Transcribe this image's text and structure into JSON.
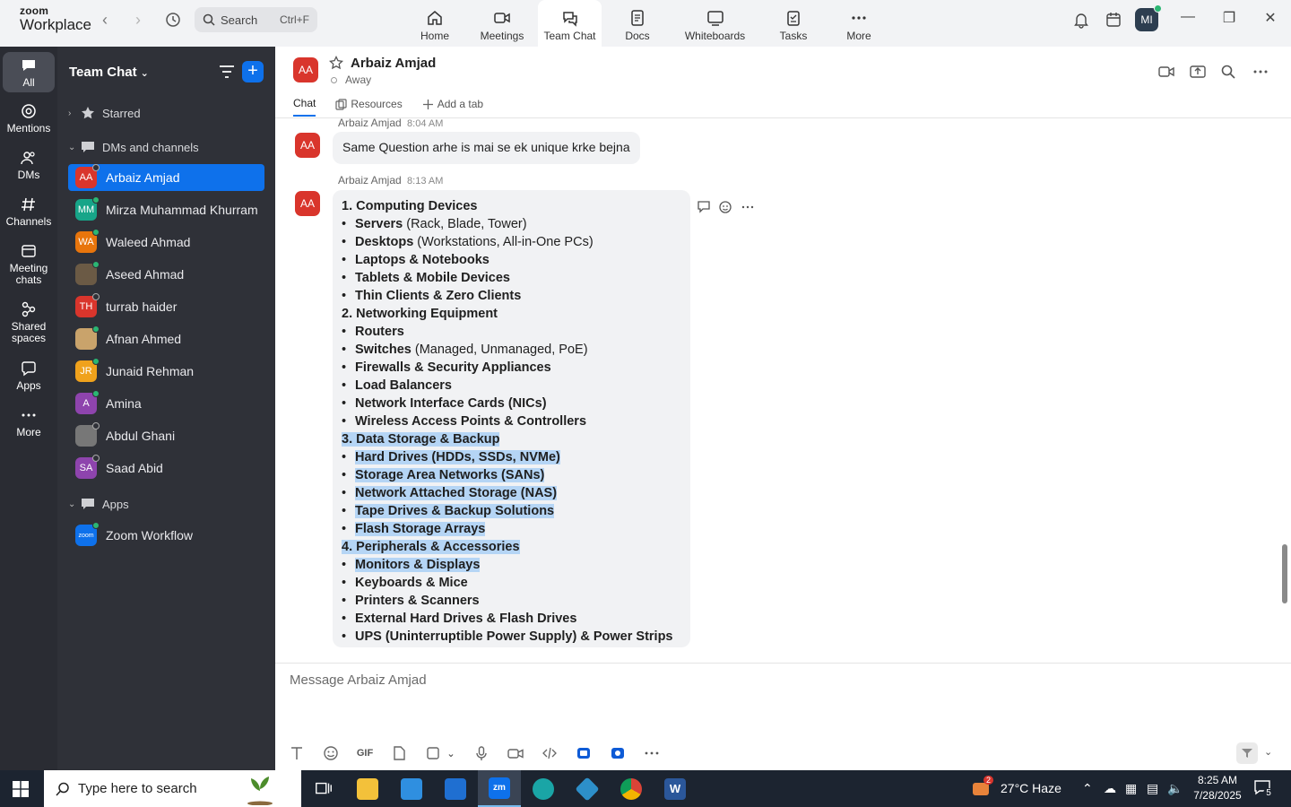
{
  "app": {
    "logo_line1": "zoom",
    "logo_line2": "Workplace",
    "search_label": "Search",
    "search_shortcut": "Ctrl+F",
    "user_initials": "MI"
  },
  "nav_tabs": [
    {
      "label": "Home",
      "icon": "home-icon"
    },
    {
      "label": "Meetings",
      "icon": "video-camera-icon"
    },
    {
      "label": "Team Chat",
      "icon": "chat-bubbles-icon"
    },
    {
      "label": "Docs",
      "icon": "document-icon"
    },
    {
      "label": "Whiteboards",
      "icon": "whiteboard-icon"
    },
    {
      "label": "Tasks",
      "icon": "tasks-icon"
    },
    {
      "label": "More",
      "icon": "more-dots-icon"
    }
  ],
  "rail": [
    {
      "label": "All"
    },
    {
      "label": "Mentions"
    },
    {
      "label": "DMs"
    },
    {
      "label": "Channels"
    },
    {
      "label": "Meeting chats"
    },
    {
      "label": "Shared spaces"
    },
    {
      "label": "Apps"
    },
    {
      "label": "More"
    }
  ],
  "sidebar": {
    "title": "Team Chat",
    "starred": "Starred",
    "dms_section": "DMs and channels",
    "apps_section": "Apps",
    "contacts": [
      {
        "initials": "AA",
        "name": "Arbaiz Amjad",
        "color": "#d9352c",
        "status": "away"
      },
      {
        "initials": "MM",
        "name": "Mirza Muhammad Khurram",
        "color": "#17a589",
        "status": "on"
      },
      {
        "initials": "WA",
        "name": "Waleed Ahmad",
        "color": "#e8750c",
        "status": "on"
      },
      {
        "initials": "",
        "name": "Aseed Ahmad",
        "color": "#6b5a45",
        "status": "on"
      },
      {
        "initials": "TH",
        "name": "turrab haider",
        "color": "#d9352c",
        "status": "away"
      },
      {
        "initials": "",
        "name": "Afnan Ahmed",
        "color": "#c9a36b",
        "status": "on"
      },
      {
        "initials": "JR",
        "name": "Junaid Rehman",
        "color": "#f0a21c",
        "status": "on"
      },
      {
        "initials": "A",
        "name": "Amina",
        "color": "#8e44ad",
        "status": "on"
      },
      {
        "initials": "",
        "name": "Abdul Ghani",
        "color": "#777777",
        "status": "away"
      },
      {
        "initials": "SA",
        "name": "Saad Abid",
        "color": "#8e44ad",
        "status": "away"
      }
    ],
    "apps": [
      {
        "initials": "zoom",
        "name": "Zoom Workflow",
        "color": "#0e71eb"
      }
    ]
  },
  "chat": {
    "contact_initials": "AA",
    "contact_name": "Arbaiz Amjad",
    "contact_status": "Away",
    "tabs": [
      "Chat",
      "Resources",
      "Add a tab"
    ],
    "messages": [
      {
        "sender": "Arbaiz Amjad",
        "time": "8:04 AM",
        "text": "Same Question arhe is mai se ek unique krke bejna"
      },
      {
        "sender": "Arbaiz Amjad",
        "time": "8:13 AM"
      }
    ],
    "list": [
      {
        "b": "1. Computing Devices",
        "r": "",
        "bullet": false,
        "hl": false
      },
      {
        "b": "Servers",
        "r": " (Rack, Blade, Tower)",
        "bullet": true,
        "hl": false
      },
      {
        "b": "Desktops",
        "r": " (Workstations, All-in-One PCs)",
        "bullet": true,
        "hl": false
      },
      {
        "b": "Laptops & Notebooks",
        "r": "",
        "bullet": true,
        "hl": false
      },
      {
        "b": "Tablets & Mobile Devices",
        "r": "",
        "bullet": true,
        "hl": false
      },
      {
        "b": "Thin Clients & Zero Clients",
        "r": "",
        "bullet": true,
        "hl": false
      },
      {
        "b": "2. Networking Equipment",
        "r": "",
        "bullet": false,
        "hl": false
      },
      {
        "b": "Routers",
        "r": "",
        "bullet": true,
        "hl": false
      },
      {
        "b": "Switches",
        "r": " (Managed, Unmanaged, PoE)",
        "bullet": true,
        "hl": false
      },
      {
        "b": "Firewalls & Security Appliances",
        "r": "",
        "bullet": true,
        "hl": false
      },
      {
        "b": "Load Balancers",
        "r": "",
        "bullet": true,
        "hl": false
      },
      {
        "b": "Network Interface Cards (NICs)",
        "r": "",
        "bullet": true,
        "hl": false
      },
      {
        "b": "Wireless Access Points & Controllers",
        "r": "",
        "bullet": true,
        "hl": false
      },
      {
        "b": "3. Data Storage & Backup",
        "r": "",
        "bullet": false,
        "hl": true
      },
      {
        "b": "Hard Drives (HDDs, SSDs, NVMe)",
        "r": "",
        "bullet": true,
        "hl": true
      },
      {
        "b": "Storage Area Networks (SANs)",
        "r": "",
        "bullet": true,
        "hl": true
      },
      {
        "b": "Network Attached Storage (NAS)",
        "r": "",
        "bullet": true,
        "hl": true
      },
      {
        "b": "Tape Drives & Backup Solutions",
        "r": "",
        "bullet": true,
        "hl": true
      },
      {
        "b": "Flash Storage Arrays",
        "r": "",
        "bullet": true,
        "hl": true
      },
      {
        "b": "4. Peripherals & Accessories",
        "r": "",
        "bullet": false,
        "hl": true
      },
      {
        "b": "Monitors & Displays",
        "r": "",
        "bullet": true,
        "hl": true
      },
      {
        "b": "Keyboards & Mice",
        "r": "",
        "bullet": true,
        "hl": false
      },
      {
        "b": "Printers & Scanners",
        "r": "",
        "bullet": true,
        "hl": false
      },
      {
        "b": "External Hard Drives & Flash Drives",
        "r": "",
        "bullet": true,
        "hl": false
      },
      {
        "b": "UPS (Uninterruptible Power Supply) & Power Strips",
        "r": "",
        "bullet": true,
        "hl": false
      }
    ],
    "composer_placeholder": "Message Arbaiz Amjad"
  },
  "taskbar": {
    "search_placeholder": "Type here to search",
    "weather": "27°C  Haze",
    "weather_badge": "2",
    "time": "8:25 AM",
    "date": "7/28/2025",
    "notif_count": "5"
  }
}
